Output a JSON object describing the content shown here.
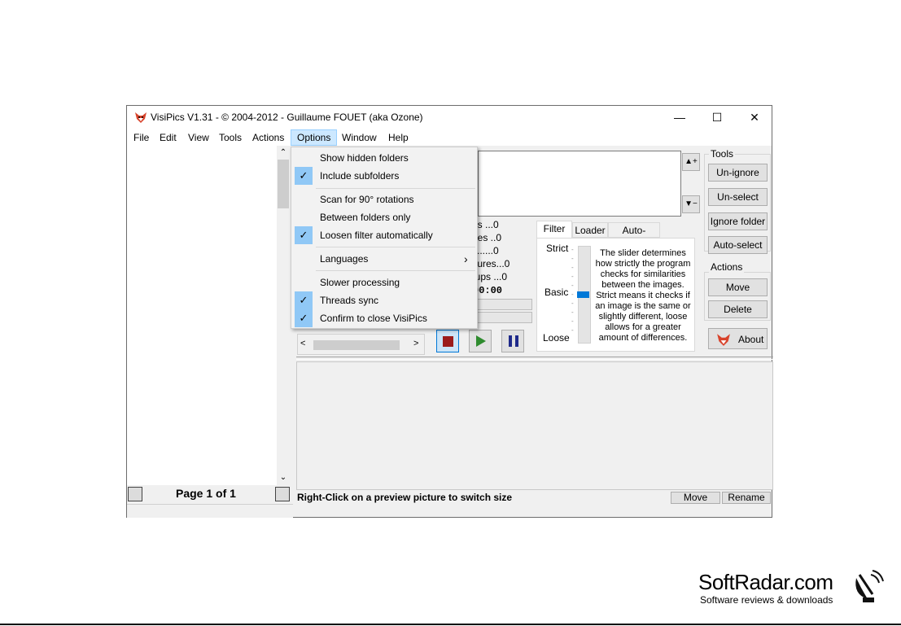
{
  "window": {
    "title": "VisiPics V1.31 - © 2004-2012 - Guillaume FOUET (aka Ozone)",
    "minimize": "—",
    "maximize": "☐",
    "close": "✕"
  },
  "menubar": [
    "File",
    "Edit",
    "View",
    "Tools",
    "Actions",
    "Options",
    "Window",
    "Help"
  ],
  "options_menu": {
    "items": [
      {
        "label": "Show hidden folders",
        "checked": false
      },
      {
        "label": "Include subfolders",
        "checked": true
      },
      {
        "label": "Scan for 90° rotations",
        "checked": false
      },
      {
        "label": "Between folders only",
        "checked": false
      },
      {
        "label": "Loosen filter automatically",
        "checked": true
      },
      {
        "label": "Languages",
        "submenu_arrow": "›"
      },
      {
        "label": "Slower processing",
        "checked": false
      },
      {
        "label": "Threads sync",
        "checked": true
      },
      {
        "label": "Confirm to close VisiPics",
        "checked": true
      }
    ],
    "check_glyph": "✓"
  },
  "stats": {
    "lines": [
      "es ...0",
      "ures ..0",
      ".........0",
      "ctures...0",
      "oups ...0"
    ],
    "timer": "00:00"
  },
  "tabs": [
    "Filter",
    "Loader",
    "Auto-Select"
  ],
  "filter": {
    "strict": "Strict",
    "basic": "Basic",
    "loose": "Loose",
    "slider_level": "Basic",
    "description": "The slider determines how strictly the program checks for similarities between the images. Strict means it checks if an image is the same or slightly different, loose allows for a greater amount of differences."
  },
  "tools": {
    "group_label": "Tools",
    "unignore": "Un-ignore",
    "unselect": "Un-select",
    "ignore_folder": "Ignore folder",
    "autoselect": "Auto-select"
  },
  "actions": {
    "group_label": "Actions",
    "move": "Move",
    "delete": "Delete",
    "about": "About"
  },
  "pagebar": {
    "label": "Page 1 of 1"
  },
  "status": {
    "hint": "Right-Click on a preview picture to switch size",
    "move": "Move",
    "rename": "Rename"
  },
  "watermark": {
    "brand": "SoftRadar.com",
    "tagline": "Software reviews & downloads"
  },
  "colors": {
    "accent": "#cce8ff",
    "check_bg": "#90c8f6",
    "stop": "#9b1b1b",
    "play": "#2e8b2e",
    "pause": "#1f2a8a"
  }
}
